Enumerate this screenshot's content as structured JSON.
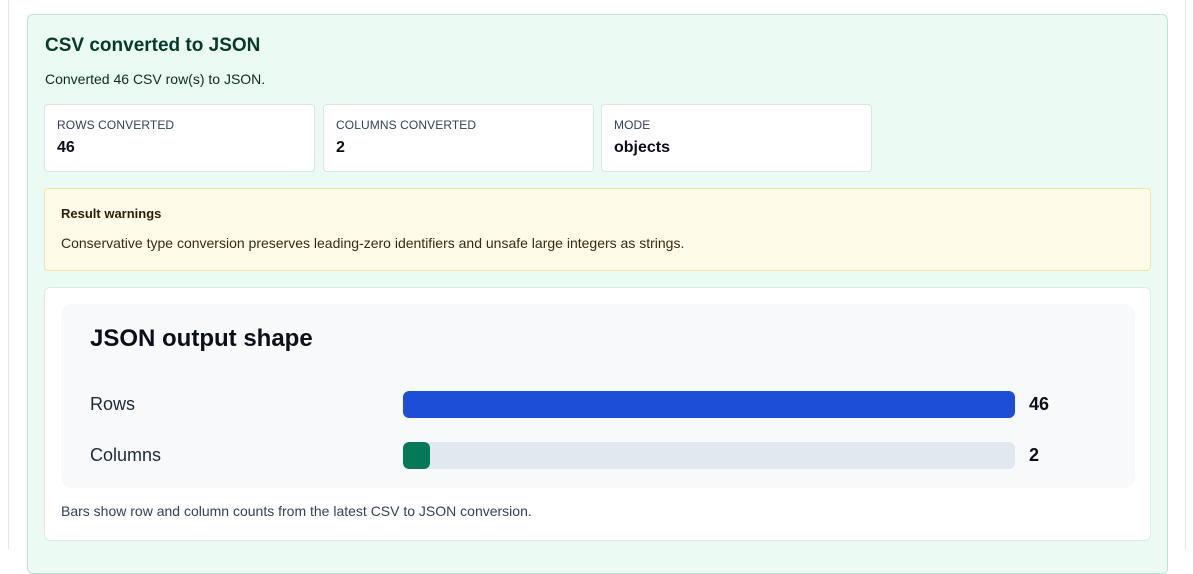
{
  "result": {
    "title": "CSV converted to JSON",
    "summary": "Converted 46 CSV row(s) to JSON."
  },
  "stats": [
    {
      "label": "ROWS CONVERTED",
      "value": "46"
    },
    {
      "label": "COLUMNS CONVERTED",
      "value": "2"
    },
    {
      "label": "MODE",
      "value": "objects"
    }
  ],
  "warnings": {
    "title": "Result warnings",
    "text": "Conservative type conversion preserves leading-zero identifiers and unsafe large integers as strings."
  },
  "chart_data": {
    "type": "bar",
    "title": "JSON output shape",
    "categories": [
      "Rows",
      "Columns"
    ],
    "values": [
      46,
      2
    ],
    "value_labels": [
      "46",
      "2"
    ],
    "colors": [
      "#1d4ed8",
      "#047857"
    ],
    "track_color": "#e2e8f0",
    "orientation": "horizontal",
    "xlim": [
      0,
      46
    ]
  },
  "footnote": "Bars show row and column counts from the latest CSV to JSON conversion."
}
